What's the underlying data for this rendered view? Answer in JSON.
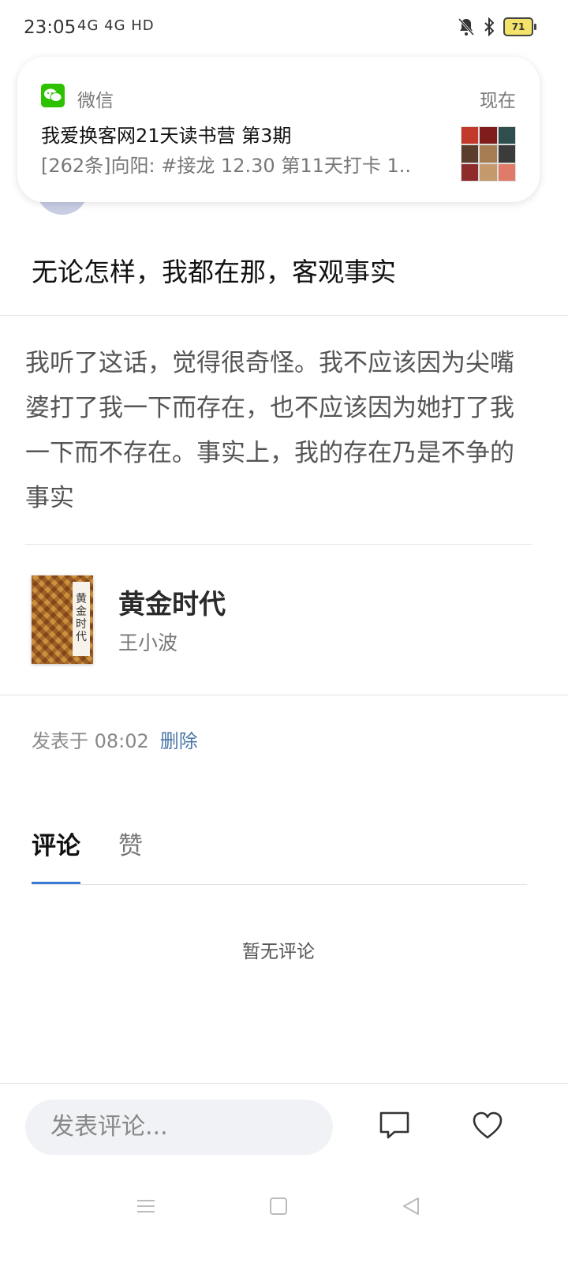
{
  "status_bar": {
    "time": "23:05",
    "network": "4G 4G HD",
    "battery": "71"
  },
  "notification": {
    "app": "微信",
    "time": "现在",
    "title": "我爱换客网21天读书营 第3期",
    "body": "[262条]向阳: #接龙 12.30 第11天打卡  1.."
  },
  "post": {
    "quote": "无论怎样，我都在那，客观事实",
    "note": "我听了这话，觉得很奇怪。我不应该因为尖嘴婆打了我一下而存在，也不应该因为她打了我一下而不存在。事实上，我的存在乃是不争的事实",
    "book": {
      "title": "黄金时代",
      "author": "王小波",
      "cover_text": "黄金时代"
    },
    "meta_time": "发表于 08:02",
    "delete_label": "删除"
  },
  "tabs": [
    {
      "label": "评论",
      "active": true
    },
    {
      "label": "赞",
      "active": false
    }
  ],
  "comments": {
    "empty_text": "暂无评论"
  },
  "bottom_bar": {
    "comment_placeholder": "发表评论..."
  },
  "colors": {
    "accent": "#3a7bd5",
    "link": "#4b77a8",
    "wechat_green": "#2dc100"
  }
}
